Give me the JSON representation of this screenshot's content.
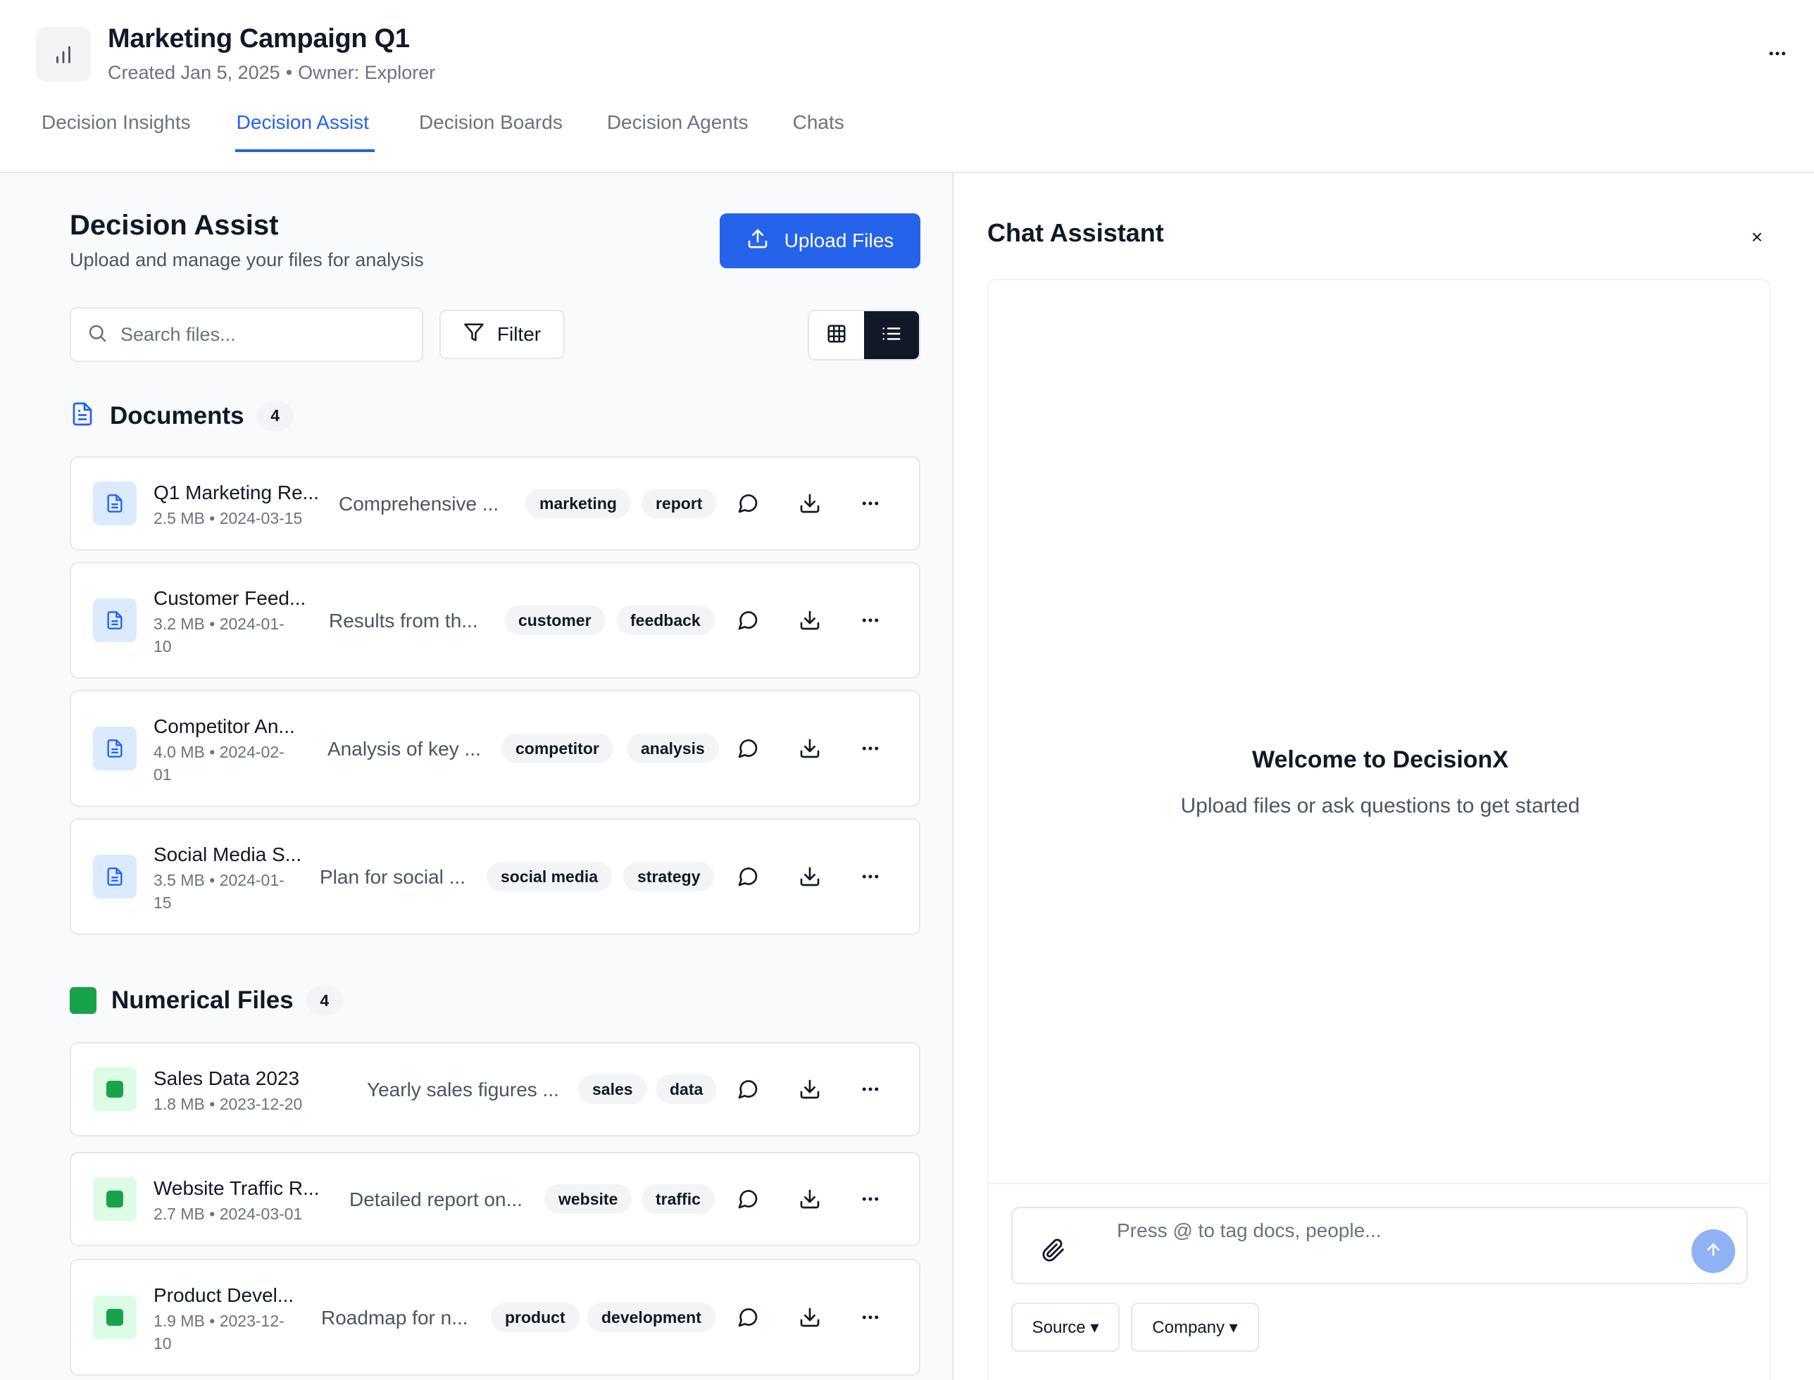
{
  "header": {
    "title": "Marketing Campaign Q1",
    "created": "Created Jan 5, 2025",
    "separator": "•",
    "owner": "Owner: Explorer",
    "app_icon": "bar-chart-icon",
    "more_icon": "more-horizontal-icon"
  },
  "tabs": [
    {
      "label": "Decision Insights",
      "active": false
    },
    {
      "label": "Decision Assist",
      "active": true
    },
    {
      "label": "Decision Boards",
      "active": false
    },
    {
      "label": "Decision Agents",
      "active": false
    },
    {
      "label": "Chats",
      "active": false
    }
  ],
  "panel": {
    "title": "Decision Assist",
    "subtitle": "Upload and manage your files for analysis",
    "upload_label": "Upload Files",
    "search_placeholder": "Search files...",
    "filter_label": "Filter",
    "view_mode": "list"
  },
  "sections": {
    "documents": {
      "label": "Documents",
      "count": "4",
      "files": [
        {
          "name": "Q1 Marketing Re...",
          "meta_line1": "2.5 MB • 2024-03-15",
          "meta_line2": "",
          "desc": "Comprehensive ...",
          "tags": [
            "marketing",
            "report"
          ]
        },
        {
          "name": "Customer Feed...",
          "meta_line1": "3.2 MB • 2024-01-",
          "meta_line2": "10",
          "desc": "Results from th...",
          "tags": [
            "customer",
            "feedback"
          ]
        },
        {
          "name": "Competitor An...",
          "meta_line1": "4.0 MB • 2024-02-",
          "meta_line2": "01",
          "desc": "Analysis of key ...",
          "tags": [
            "competitor",
            "analysis"
          ]
        },
        {
          "name": "Social Media S...",
          "meta_line1": "3.5 MB • 2024-01-",
          "meta_line2": "15",
          "desc": "Plan for social ...",
          "tags": [
            "social media",
            "strategy"
          ]
        }
      ]
    },
    "numerical": {
      "label": "Numerical Files",
      "count": "4",
      "files": [
        {
          "name": "Sales Data 2023",
          "meta_line1": "1.8 MB • 2023-12-20",
          "meta_line2": "",
          "desc": "Yearly sales figures ...",
          "tags": [
            "sales",
            "data"
          ]
        },
        {
          "name": "Website Traffic R...",
          "meta_line1": "2.7 MB • 2024-03-01",
          "meta_line2": "",
          "desc": "Detailed report on...",
          "tags": [
            "website",
            "traffic"
          ]
        },
        {
          "name": "Product Devel...",
          "meta_line1": "1.9 MB • 2023-12-",
          "meta_line2": "10",
          "desc": "Roadmap for n...",
          "tags": [
            "product",
            "development"
          ]
        }
      ]
    }
  },
  "chat": {
    "title": "Chat Assistant",
    "close_label": "×",
    "welcome_title": "Welcome to DecisionX",
    "welcome_sub": "Upload files or ask questions to get started",
    "input_placeholder": "Press @ to tag docs, people...",
    "source_label": "Source ▾",
    "company_label": "Company ▾"
  },
  "colors": {
    "accent": "#2563eb",
    "doc_icon_bg": "#dbeafe",
    "num_icon": "#16a34a",
    "num_icon_bg": "#dcfce7",
    "send_bg": "#8fb2f5"
  }
}
